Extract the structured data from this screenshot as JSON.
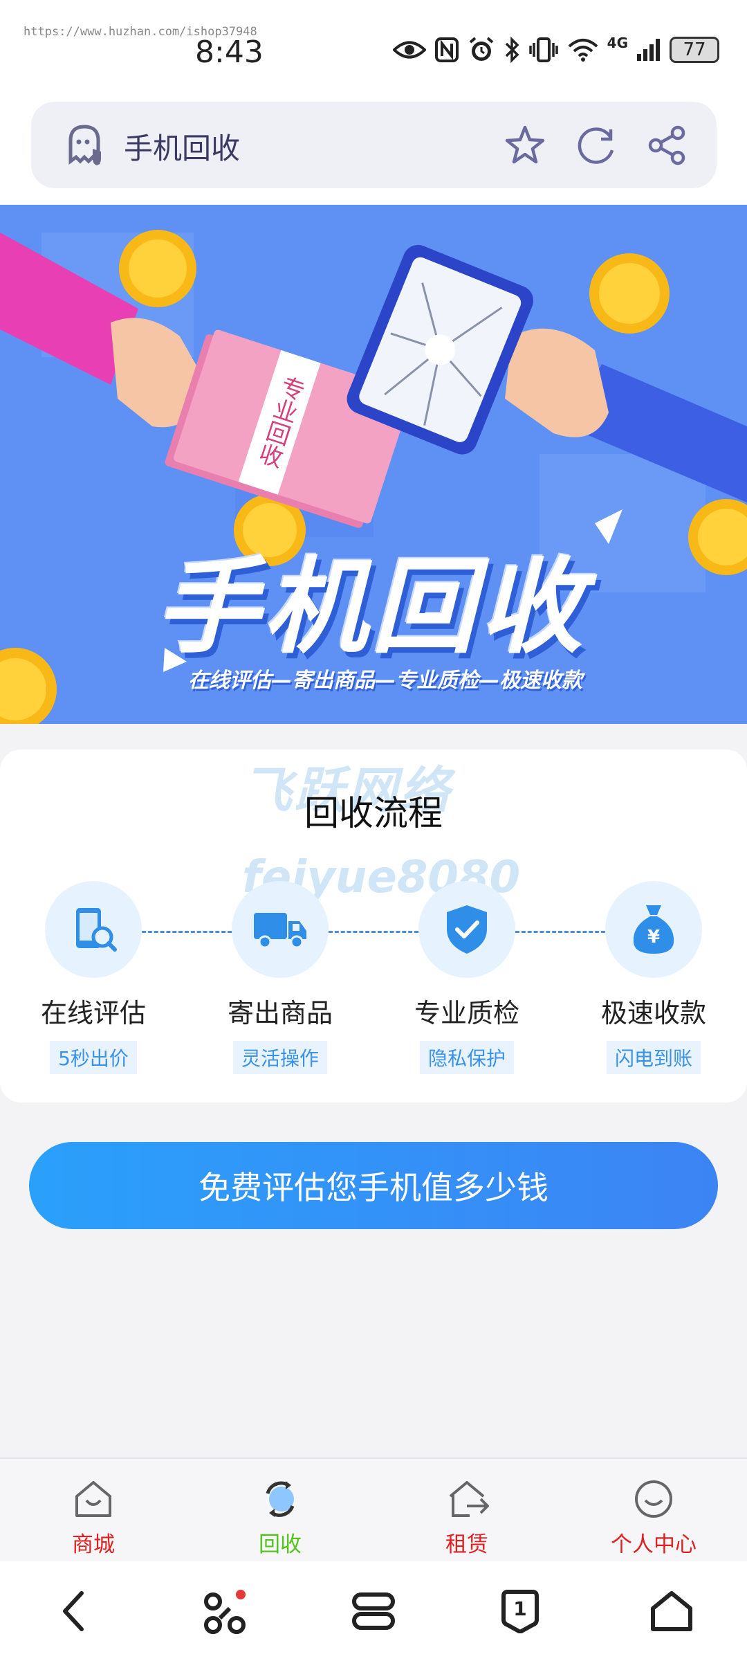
{
  "status_bar": {
    "url_watermark": "https://www.huzhan.com/ishop37948",
    "time": "8:43",
    "network": "4G",
    "battery": "77"
  },
  "browser": {
    "page_title": "手机回收",
    "icons": [
      "ghost-shield-icon",
      "star-icon",
      "refresh-icon",
      "share-icon"
    ]
  },
  "banner": {
    "title": "手机回收",
    "subtitle": "在线评估—寄出商品—专业质检—极速收款",
    "cash_band_text": "专业回收"
  },
  "process": {
    "title": "回收流程",
    "watermark_cn": "飞跃网络",
    "watermark_en": "feiyue8080",
    "steps": [
      {
        "label": "在线评估",
        "sub": "5秒出价",
        "icon": "phone-search-icon"
      },
      {
        "label": "寄出商品",
        "sub": "灵活操作",
        "icon": "truck-icon"
      },
      {
        "label": "专业质检",
        "sub": "隐私保护",
        "icon": "shield-check-icon"
      },
      {
        "label": "极速收款",
        "sub": "闪电到账",
        "icon": "money-bag-icon"
      }
    ]
  },
  "cta": {
    "label": "免费评估您手机值多少钱"
  },
  "tabbar": {
    "items": [
      {
        "label": "商城",
        "color": "#e02020",
        "icon": "shop-icon"
      },
      {
        "label": "回收",
        "color": "#52c41a",
        "icon": "recycle-icon",
        "active": true
      },
      {
        "label": "租赁",
        "color": "#e02020",
        "icon": "rent-icon"
      },
      {
        "label": "个人中心",
        "color": "#e02020",
        "icon": "smile-icon"
      }
    ]
  },
  "system_nav": {
    "tabs_count": "1"
  },
  "colors": {
    "accent": "#3a92e6",
    "cta_start": "#2aa0fb",
    "cta_end": "#3c84f4",
    "banner_bg": "#5b8df3"
  }
}
